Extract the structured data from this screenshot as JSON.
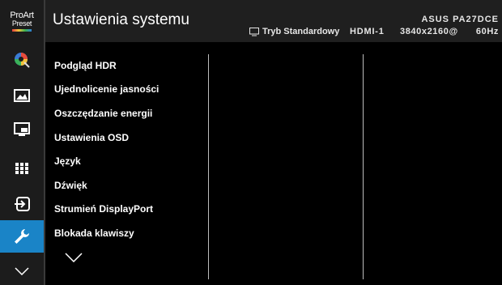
{
  "logo": {
    "top": "ProArt",
    "bottom": "Preset"
  },
  "header": {
    "title": "Ustawienia systemu",
    "mode_label": "Tryb Standardowy",
    "input": "HDMI-1",
    "model": "ASUS PA27DCE",
    "resolution": "3840x2160@",
    "refresh": "60Hz"
  },
  "sidebar": {
    "items": [
      {
        "icon": "color-wheel-icon"
      },
      {
        "icon": "image-icon"
      },
      {
        "icon": "pip-icon"
      },
      {
        "icon": "grid-icon"
      },
      {
        "icon": "input-select-icon"
      },
      {
        "icon": "wrench-icon",
        "active": true
      },
      {
        "icon": "chevron-down-icon"
      }
    ],
    "accent_color": "#1a84c7"
  },
  "menu": {
    "items": [
      "Podgląd HDR",
      "Ujednolicenie jasności",
      "Oszczędzanie energii",
      "Ustawienia OSD",
      "Język",
      "Dźwięk",
      "Strumień DisplayPort",
      "Blokada klawiszy"
    ],
    "more_icon": "chevron-down-icon"
  }
}
